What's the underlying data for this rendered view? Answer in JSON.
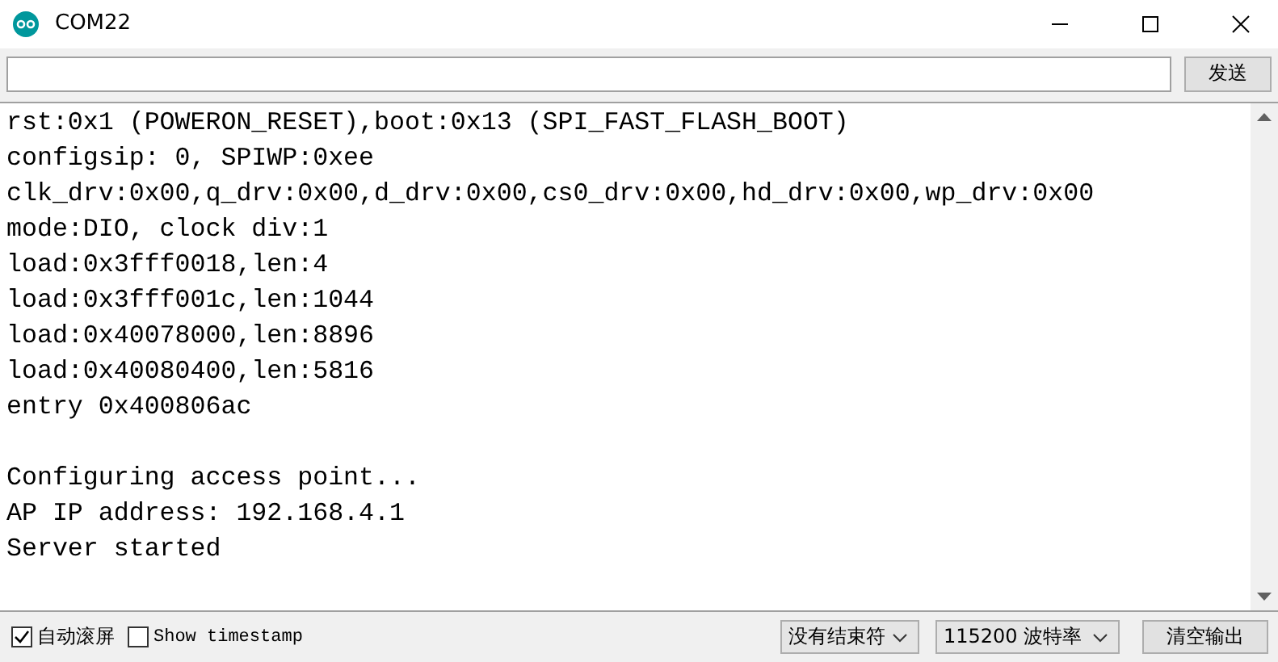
{
  "window": {
    "title": "COM22"
  },
  "send": {
    "button": "发送"
  },
  "output": {
    "blocks": [
      [
        "rst:0x1 (POWERON_RESET),boot:0x13 (SPI_FAST_FLASH_BOOT)",
        "configsip: 0, SPIWP:0xee",
        "clk_drv:0x00,q_drv:0x00,d_drv:0x00,cs0_drv:0x00,hd_drv:0x00,wp_drv:0x00",
        "mode:DIO, clock div:1",
        "load:0x3fff0018,len:4",
        "load:0x3fff001c,len:1044",
        "load:0x40078000,len:8896",
        "load:0x40080400,len:5816",
        "entry 0x400806ac"
      ],
      [
        "Configuring access point...",
        "AP IP address: 192.168.4.1",
        "Server started"
      ]
    ]
  },
  "options": [
    {
      "label": "自动滚屏",
      "checked": true
    },
    {
      "label": "Show timestamp",
      "checked": false
    }
  ],
  "dropdowns": [
    {
      "value": "没有结束符"
    },
    {
      "value": "115200 波特率"
    }
  ],
  "clear_button": "清空输出"
}
